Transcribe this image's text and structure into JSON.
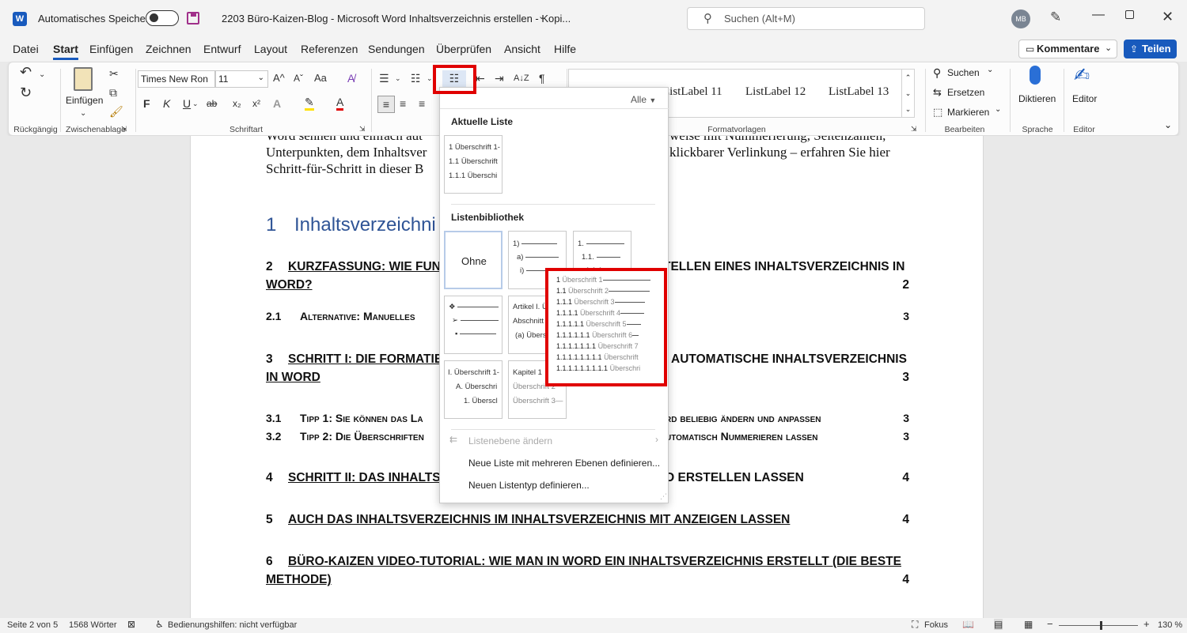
{
  "titlebar": {
    "autosave_label": "Automatisches Speichern",
    "doc_title": "2203 Büro-Kaizen-Blog - Microsoft Word Inhaltsverzeichnis erstellen - Kopi...",
    "search_placeholder": "Suchen (Alt+M)",
    "avatar_initials": "MB"
  },
  "menu": {
    "tabs": [
      "Datei",
      "Start",
      "Einfügen",
      "Zeichnen",
      "Entwurf",
      "Layout",
      "Referenzen",
      "Sendungen",
      "Überprüfen",
      "Ansicht",
      "Hilfe"
    ],
    "active": "Start",
    "comments_label": "Kommentare",
    "share_label": "Teilen"
  },
  "ribbon": {
    "groups": {
      "undo": "Rückgängig",
      "clipboard": "Zwischenablage",
      "font": "Schriftart",
      "styles": "Formatvorlagen",
      "editing": "Bearbeiten",
      "voice": "Sprache",
      "editor": "Editor"
    },
    "paste_label": "Einfügen",
    "font_name": "Times New Ron",
    "font_size": "11",
    "styles": [
      "ListLabel 11",
      "ListLabel 12",
      "ListLabel 13"
    ],
    "find_label": "Suchen",
    "replace_label": "Ersetzen",
    "select_label": "Markieren",
    "dictate_label": "Diktieren",
    "editor_label": "Editor",
    "format_buttons": {
      "bold": "F",
      "italic": "K",
      "underline": "U",
      "strike": "ab",
      "sub": "x₂",
      "sup": "x²",
      "case": "Aa",
      "grow": "A^",
      "shrink": "Aˇ",
      "pilcrow": "¶",
      "sort": "A↓Z"
    }
  },
  "document": {
    "intro_lines": [
      "Word sehnen und einfach aut",
      "Unterpunkten, dem Inhaltsver",
      "Schritt-für-Schritt in dieser B",
      "weise mit Nummerierung, Seitenzahlen,",
      "klickbarer Verlinkung – erfahren Sie hier"
    ],
    "heading_num": "1",
    "heading_text": "Inhaltsverzeichni",
    "toc": [
      {
        "num": "2",
        "left": "KURZFASSUNG: WIE FUN",
        "right": "TELLEN EINES INHALTSVERZEICHNIS IN",
        "line2": "WORD?",
        "page": "2"
      },
      {
        "num": "2.1",
        "left": "Alternative: Manuelles",
        "right": "",
        "page": "3"
      },
      {
        "num": "3",
        "left": "SCHRITT I: DIE FORMATIE",
        "right": "AUTOMATISCHE INHALTSVERZEICHNIS",
        "line2": "IN WORD",
        "page": "3"
      },
      {
        "num": "3.1",
        "left": "Tipp 1: Sie können das La",
        "right": "rd beliebig ändern und anpassen",
        "page": "3"
      },
      {
        "num": "3.2",
        "left": "Tipp 2: Die Überschriften",
        "right": "utomatisch Nummerieren lassen",
        "page": "3"
      },
      {
        "num": "4",
        "left": "SCHRITT II: DAS INHALTSV",
        "right": "D ERSTELLEN LASSEN",
        "page": "4"
      },
      {
        "num": "5",
        "left": "AUCH DAS INHALTSVERZEICHNIS IM INHALTSVERZEICHNIS MIT ANZEIGEN LASSEN",
        "right": "",
        "page": "4"
      },
      {
        "num": "6",
        "left": "BÜRO-KAIZEN VIDEO-TUTORIAL: WIE MAN IN WORD EIN INHALTSVERZEICHNIS ERSTELLT (DIE BESTE",
        "right": "",
        "line2": "METHODE)",
        "page": "4"
      }
    ]
  },
  "dropdown": {
    "filter_label": "Alle",
    "current_list_heading": "Aktuelle Liste",
    "library_heading": "Listenbibliothek",
    "none_label": "Ohne",
    "current_tile": [
      "1 Überschrift 1-",
      "1.1 Überschrift",
      "1.1.1 Überschi"
    ],
    "tile_paren": [
      "1)",
      "a)",
      "i)"
    ],
    "tile_decimal": [
      "1.",
      "1.1.",
      "1.1.1."
    ],
    "tile_article": [
      "Artikel I. Ü",
      "Abschnitt",
      "(a) Übers"
    ],
    "tile_roman": [
      "I. Überschrift 1-",
      "A. Überschri",
      "1. Überscl"
    ],
    "tile_chapter": [
      "Kapitel 1",
      "Überschrift 2",
      "Überschrift 3—"
    ],
    "preview_nums": [
      "1",
      "1.1",
      "1.1.1",
      "1.1.1.1",
      "1.1.1.1.1",
      "1.1.1.1.1.1",
      "1.1.1.1.1.1.1",
      "1.1.1.1.1.1.1.1",
      "1.1.1.1.1.1.1.1.1"
    ],
    "preview_labels": [
      "Überschrift 1",
      "Überschrift 2",
      "Überschrift 3",
      "Überschrift 4",
      "Überschrift 5",
      "Überschrift 6",
      "Überschrift 7",
      "Überschrift",
      "Überschri"
    ],
    "change_level": "Listenebene ändern",
    "define_multilevel": "Neue Liste mit mehreren Ebenen definieren...",
    "define_style": "Neuen Listentyp definieren..."
  },
  "status": {
    "page": "Seite 2 von 5",
    "words": "1568 Wörter",
    "accessibility": "Bedienungshilfen: nicht verfügbar",
    "focus": "Fokus",
    "zoom": "130 %"
  },
  "colors": {
    "accent": "#185abd",
    "highlight": "#e00000",
    "heading": "#2f5496"
  }
}
